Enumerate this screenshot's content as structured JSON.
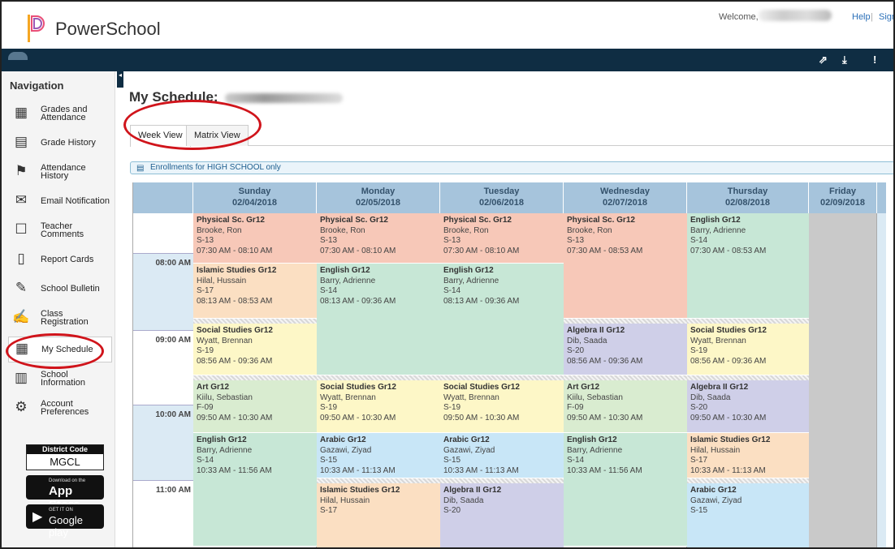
{
  "header": {
    "app_name": "PowerSchool",
    "welcome": "Welcome,",
    "help": "Help",
    "separator": "|",
    "sign": "Sign"
  },
  "topbar": {
    "icons": [
      "external-link-icon",
      "download-icon",
      "alert-icon"
    ]
  },
  "sidebar": {
    "title": "Navigation",
    "items": [
      {
        "label": "Grades and Attendance",
        "icon": "grades-icon"
      },
      {
        "label": "Grade History",
        "icon": "grade-history-icon"
      },
      {
        "label": "Attendance History",
        "icon": "attendance-icon"
      },
      {
        "label": "Email Notification",
        "icon": "email-icon"
      },
      {
        "label": "Teacher Comments",
        "icon": "comments-icon"
      },
      {
        "label": "Report Cards",
        "icon": "report-cards-icon"
      },
      {
        "label": "School Bulletin",
        "icon": "bulletin-icon"
      },
      {
        "label": "Class Registration",
        "icon": "registration-icon"
      },
      {
        "label": "My Schedule",
        "icon": "schedule-icon"
      },
      {
        "label": "School Information",
        "icon": "school-icon"
      },
      {
        "label": "Account Preferences",
        "icon": "preferences-icon"
      }
    ],
    "district_code_title": "District Code",
    "district_code": "MGCL",
    "app_store_small": "Download on the",
    "app_store": "App Store",
    "google_play_small": "GET IT ON",
    "google_play": "Google play"
  },
  "main": {
    "title": "My Schedule:",
    "tabs": [
      "Week View",
      "Matrix View"
    ],
    "notice": "Enrollments for HIGH SCHOOL only"
  },
  "schedule": {
    "days": [
      {
        "name": "Sunday",
        "date": "02/04/2018"
      },
      {
        "name": "Monday",
        "date": "02/05/2018"
      },
      {
        "name": "Tuesday",
        "date": "02/06/2018"
      },
      {
        "name": "Wednesday",
        "date": "02/07/2018"
      },
      {
        "name": "Thursday",
        "date": "02/08/2018"
      },
      {
        "name": "Friday",
        "date": "02/09/2018"
      }
    ],
    "times": [
      "08:00 AM",
      "09:00 AM",
      "10:00 AM",
      "11:00 AM"
    ],
    "blocks": [
      {
        "day": 0,
        "course": "Physical Sc. Gr12",
        "teacher": "Brooke, Ron",
        "room": "S-13",
        "time": "07:30 AM - 08:10 AM",
        "color": "pe"
      },
      {
        "day": 0,
        "course": "Islamic Studies Gr12",
        "teacher": "Hilal, Hussain",
        "room": "S-17",
        "time": "08:13 AM - 08:53 AM",
        "color": "is"
      },
      {
        "day": 0,
        "course": "Social Studies Gr12",
        "teacher": "Wyatt, Brennan",
        "room": "S-19",
        "time": "08:56 AM - 09:36 AM",
        "color": "ss"
      },
      {
        "day": 0,
        "course": "Art Gr12",
        "teacher": "Kiilu, Sebastian",
        "room": "F-09",
        "time": "09:50 AM - 10:30 AM",
        "color": "art"
      },
      {
        "day": 0,
        "course": "English Gr12",
        "teacher": "Barry, Adrienne",
        "room": "S-14",
        "time": "10:33 AM - 11:56 AM",
        "color": "en"
      },
      {
        "day": 1,
        "course": "Physical Sc. Gr12",
        "teacher": "Brooke, Ron",
        "room": "S-13",
        "time": "07:30 AM - 08:10 AM",
        "color": "pe"
      },
      {
        "day": 1,
        "course": "English Gr12",
        "teacher": "Barry, Adrienne",
        "room": "S-14",
        "time": "08:13 AM - 09:36 AM",
        "color": "en"
      },
      {
        "day": 1,
        "course": "Social Studies Gr12",
        "teacher": "Wyatt, Brennan",
        "room": "S-19",
        "time": "09:50 AM - 10:30 AM",
        "color": "ss"
      },
      {
        "day": 1,
        "course": "Arabic Gr12",
        "teacher": "Gazawi, Ziyad",
        "room": "S-15",
        "time": "10:33 AM - 11:13 AM",
        "color": "ar"
      },
      {
        "day": 1,
        "course": "Islamic Studies Gr12",
        "teacher": "Hilal, Hussain",
        "room": "S-17",
        "time": "",
        "color": "is"
      },
      {
        "day": 2,
        "course": "Physical Sc. Gr12",
        "teacher": "Brooke, Ron",
        "room": "S-13",
        "time": "07:30 AM - 08:10 AM",
        "color": "pe"
      },
      {
        "day": 2,
        "course": "English Gr12",
        "teacher": "Barry, Adrienne",
        "room": "S-14",
        "time": "08:13 AM - 09:36 AM",
        "color": "en"
      },
      {
        "day": 2,
        "course": "Social Studies Gr12",
        "teacher": "Wyatt, Brennan",
        "room": "S-19",
        "time": "09:50 AM - 10:30 AM",
        "color": "ss"
      },
      {
        "day": 2,
        "course": "Arabic Gr12",
        "teacher": "Gazawi, Ziyad",
        "room": "S-15",
        "time": "10:33 AM - 11:13 AM",
        "color": "ar"
      },
      {
        "day": 2,
        "course": "Algebra II Gr12",
        "teacher": "Dib, Saada",
        "room": "S-20",
        "time": "",
        "color": "al"
      },
      {
        "day": 3,
        "course": "Physical Sc. Gr12",
        "teacher": "Brooke, Ron",
        "room": "S-13",
        "time": "07:30 AM - 08:53 AM",
        "color": "pe"
      },
      {
        "day": 3,
        "course": "Algebra II Gr12",
        "teacher": "Dib, Saada",
        "room": "S-20",
        "time": "08:56 AM - 09:36 AM",
        "color": "al"
      },
      {
        "day": 3,
        "course": "Art Gr12",
        "teacher": "Kiilu, Sebastian",
        "room": "F-09",
        "time": "09:50 AM - 10:30 AM",
        "color": "art"
      },
      {
        "day": 3,
        "course": "English Gr12",
        "teacher": "Barry, Adrienne",
        "room": "S-14",
        "time": "10:33 AM - 11:56 AM",
        "color": "en"
      },
      {
        "day": 4,
        "course": "English Gr12",
        "teacher": "Barry, Adrienne",
        "room": "S-14",
        "time": "07:30 AM - 08:53 AM",
        "color": "en"
      },
      {
        "day": 4,
        "course": "Social Studies Gr12",
        "teacher": "Wyatt, Brennan",
        "room": "S-19",
        "time": "08:56 AM - 09:36 AM",
        "color": "ss"
      },
      {
        "day": 4,
        "course": "Algebra II Gr12",
        "teacher": "Dib, Saada",
        "room": "S-20",
        "time": "09:50 AM - 10:30 AM",
        "color": "al"
      },
      {
        "day": 4,
        "course": "Islamic Studies Gr12",
        "teacher": "Hilal, Hussain",
        "room": "S-17",
        "time": "10:33 AM - 11:13 AM",
        "color": "is"
      },
      {
        "day": 4,
        "course": "Arabic Gr12",
        "teacher": "Gazawi, Ziyad",
        "room": "S-15",
        "time": "",
        "color": "ar"
      }
    ]
  },
  "colors": {
    "topbar": "#0f2d43",
    "day_header": "#a6c4dc",
    "highlight_circle": "#d0141b"
  }
}
